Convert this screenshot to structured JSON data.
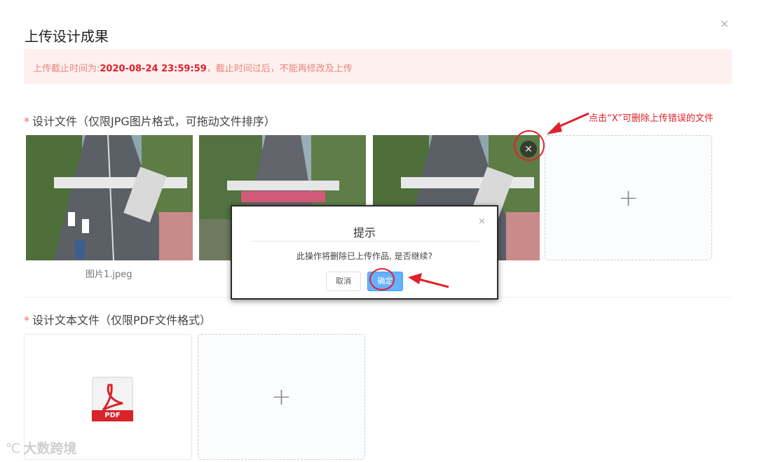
{
  "dialog": {
    "title": "上传设计成果",
    "close_icon": "×"
  },
  "alert": {
    "prefix": "上传截止时间为:",
    "deadline": "2020-08-24 23:59:59",
    "suffix": "，截止时间过后，不能再修改及上传"
  },
  "design_files": {
    "required_mark": "*",
    "label": "设计文件（仅限JPG图片格式，可拖动文件排序）",
    "items": [
      {
        "caption": "图片1.jpeg"
      },
      {
        "caption": ""
      },
      {
        "caption": ""
      }
    ],
    "remove_icon": "×",
    "upload_plus": "+"
  },
  "annotation": {
    "text": "点击“X”可删除上传错误的文件"
  },
  "design_text_files": {
    "required_mark": "*",
    "label": "设计文本文件（仅限PDF文件格式）",
    "pdf_badge": "PDF",
    "upload_plus": "+"
  },
  "confirm_modal": {
    "title": "提示",
    "close_icon": "×",
    "message": "此操作将删除已上传作品, 是否继续?",
    "cancel_label": "取消",
    "ok_label": "确定"
  },
  "watermark": {
    "logo": "℃",
    "text": "大数跨境"
  },
  "colors": {
    "accent_red": "#e0202a",
    "primary_blue": "#409eff",
    "alert_bg": "#fef0ef"
  }
}
